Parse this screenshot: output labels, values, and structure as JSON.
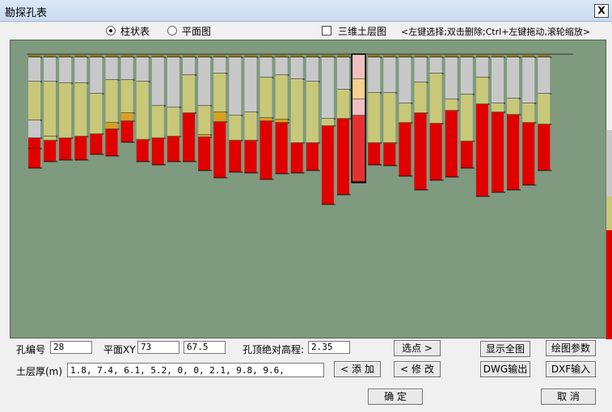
{
  "window": {
    "title": "勘探孔表",
    "close_label": "X"
  },
  "view_modes": {
    "option1": "柱状表",
    "option2": "平面图",
    "selected": "柱状表"
  },
  "checkbox_3d": {
    "label": "三维土层图",
    "checked": false
  },
  "hint": "<左键选择;双击删除;Ctrl+左键拖动,滚轮缩放>",
  "form": {
    "hole_no_label": "孔编号",
    "hole_no": "28",
    "plane_xy_label": "平面XY",
    "x": "73",
    "y": "67.5",
    "elev_label": "孔顶绝对高程:",
    "elev": "2.35",
    "layers_label": "土层厚(m)",
    "layers": "1.8, 7.4, 6.1, 5.2, 0, 0, 2.1, 9.8, 9.6,"
  },
  "buttons": {
    "select_point": "选点 >",
    "show_all": "显示全图",
    "draw_params": "绘图参数",
    "add": "< 添 加",
    "modify": "< 修 改",
    "dwg_out": "DWG输出",
    "dxf_in": "DXF输入",
    "ok": "确 定",
    "cancel": "取 消"
  },
  "colors": {
    "canvas_bg": "#7f9a7f",
    "top": "#8a7a20",
    "grey": "#c8c8c8",
    "yellow": "#c8c878",
    "orange": "#d8a020",
    "red": "#e00000",
    "sel_pink": "#f0c0c0",
    "sel_peach": "#f8d090",
    "sel_red": "#e83030"
  },
  "boreholes": [
    {
      "layers": [
        [
          "top",
          3
        ],
        [
          "grey",
          30
        ],
        [
          "yellow",
          48
        ],
        [
          "grey",
          22
        ],
        [
          "red",
          13
        ],
        [
          "red",
          24
        ]
      ]
    },
    {
      "layers": [
        [
          "top",
          3
        ],
        [
          "grey",
          30
        ],
        [
          "yellow",
          68
        ],
        [
          "yellow",
          5
        ],
        [
          "red",
          26
        ]
      ]
    },
    {
      "layers": [
        [
          "top",
          3
        ],
        [
          "grey",
          32
        ],
        [
          "yellow",
          68
        ],
        [
          "red",
          27
        ]
      ]
    },
    {
      "layers": [
        [
          "top",
          3
        ],
        [
          "grey",
          32
        ],
        [
          "yellow",
          66
        ],
        [
          "red",
          29
        ]
      ]
    },
    {
      "layers": [
        [
          "top",
          3
        ],
        [
          "grey",
          45
        ],
        [
          "yellow",
          50
        ],
        [
          "red",
          25
        ]
      ]
    },
    {
      "layers": [
        [
          "top",
          3
        ],
        [
          "grey",
          28
        ],
        [
          "yellow",
          53
        ],
        [
          "orange",
          8
        ],
        [
          "red",
          33
        ]
      ]
    },
    {
      "layers": [
        [
          "top",
          3
        ],
        [
          "grey",
          28
        ],
        [
          "yellow",
          41
        ],
        [
          "orange",
          10
        ],
        [
          "red",
          26
        ]
      ]
    },
    {
      "layers": [
        [
          "top",
          3
        ],
        [
          "grey",
          30
        ],
        [
          "yellow",
          72
        ],
        [
          "red",
          27
        ]
      ]
    },
    {
      "layers": [
        [
          "top",
          3
        ],
        [
          "grey",
          60
        ],
        [
          "yellow",
          40
        ],
        [
          "red",
          33
        ]
      ]
    },
    {
      "layers": [
        [
          "top",
          3
        ],
        [
          "grey",
          62
        ],
        [
          "yellow",
          36
        ],
        [
          "red",
          31
        ]
      ]
    },
    {
      "layers": [
        [
          "top",
          3
        ],
        [
          "grey",
          22
        ],
        [
          "yellow",
          47
        ],
        [
          "red",
          60
        ]
      ]
    },
    {
      "layers": [
        [
          "top",
          3
        ],
        [
          "grey",
          60
        ],
        [
          "yellow",
          36
        ],
        [
          "orange",
          3
        ],
        [
          "red",
          41
        ]
      ]
    },
    {
      "layers": [
        [
          "top",
          3
        ],
        [
          "grey",
          20
        ],
        [
          "yellow",
          48
        ],
        [
          "orange",
          12
        ],
        [
          "red",
          69
        ]
      ]
    },
    {
      "layers": [
        [
          "top",
          3
        ],
        [
          "grey",
          72
        ],
        [
          "yellow",
          31
        ],
        [
          "red",
          39
        ]
      ]
    },
    {
      "layers": [
        [
          "top",
          3
        ],
        [
          "grey",
          68
        ],
        [
          "yellow",
          35
        ],
        [
          "red",
          40
        ]
      ]
    },
    {
      "layers": [
        [
          "top",
          3
        ],
        [
          "grey",
          25
        ],
        [
          "yellow",
          50
        ],
        [
          "orange",
          4
        ],
        [
          "red",
          72
        ]
      ]
    },
    {
      "layers": [
        [
          "top",
          3
        ],
        [
          "grey",
          22
        ],
        [
          "yellow",
          55
        ],
        [
          "orange",
          4
        ],
        [
          "red",
          63
        ]
      ]
    },
    {
      "layers": [
        [
          "top",
          3
        ],
        [
          "grey",
          27
        ],
        [
          "yellow",
          79
        ],
        [
          "red",
          37
        ]
      ]
    },
    {
      "layers": [
        [
          "top",
          3
        ],
        [
          "grey",
          30
        ],
        [
          "yellow",
          76
        ],
        [
          "red",
          34
        ]
      ]
    },
    {
      "layers": [
        [
          "top",
          3
        ],
        [
          "grey",
          76
        ],
        [
          "yellow",
          9
        ],
        [
          "red",
          97
        ]
      ]
    },
    {
      "layers": [
        [
          "top",
          3
        ],
        [
          "grey",
          40
        ],
        [
          "yellow",
          36
        ],
        [
          "red",
          94
        ]
      ]
    },
    {
      "layers": [
        [
          "sel_pink",
          30
        ],
        [
          "sel_peach",
          25
        ],
        [
          "sel_pink",
          20
        ],
        [
          "sel_red",
          82
        ]
      ]
    },
    {
      "layers": [
        [
          "top",
          3
        ],
        [
          "grey",
          44
        ],
        [
          "yellow",
          62
        ],
        [
          "red",
          27
        ]
      ]
    },
    {
      "layers": [
        [
          "top",
          3
        ],
        [
          "grey",
          44
        ],
        [
          "yellow",
          62
        ],
        [
          "red",
          28
        ]
      ]
    },
    {
      "layers": [
        [
          "top",
          3
        ],
        [
          "grey",
          57
        ],
        [
          "yellow",
          24
        ],
        [
          "red",
          66
        ]
      ]
    },
    {
      "layers": [
        [
          "top",
          3
        ],
        [
          "grey",
          31
        ],
        [
          "yellow",
          38
        ],
        [
          "red",
          95
        ]
      ]
    },
    {
      "layers": [
        [
          "top",
          3
        ],
        [
          "grey",
          20
        ],
        [
          "yellow",
          62
        ],
        [
          "red",
          70
        ]
      ]
    },
    {
      "layers": [
        [
          "top",
          3
        ],
        [
          "grey",
          52
        ],
        [
          "yellow",
          14
        ],
        [
          "red",
          82
        ]
      ]
    },
    {
      "layers": [
        [
          "top",
          3
        ],
        [
          "grey",
          46
        ],
        [
          "yellow",
          58
        ],
        [
          "red",
          33
        ]
      ]
    },
    {
      "layers": [
        [
          "top",
          3
        ],
        [
          "grey",
          25
        ],
        [
          "yellow",
          33
        ],
        [
          "red",
          114
        ]
      ]
    },
    {
      "layers": [
        [
          "top",
          3
        ],
        [
          "grey",
          57
        ],
        [
          "yellow",
          11
        ],
        [
          "red",
          99
        ]
      ]
    },
    {
      "layers": [
        [
          "top",
          3
        ],
        [
          "grey",
          51
        ],
        [
          "yellow",
          20
        ],
        [
          "red",
          93
        ]
      ]
    },
    {
      "layers": [
        [
          "top",
          3
        ],
        [
          "grey",
          57
        ],
        [
          "yellow",
          24
        ],
        [
          "red",
          77
        ]
      ]
    },
    {
      "layers": [
        [
          "top",
          3
        ],
        [
          "grey",
          45
        ],
        [
          "yellow",
          38
        ],
        [
          "red",
          57
        ]
      ]
    }
  ]
}
